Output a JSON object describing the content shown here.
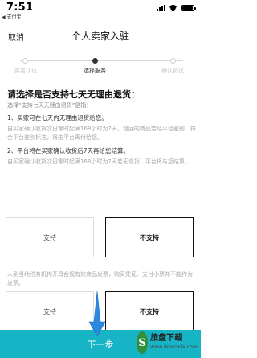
{
  "status_bar": {
    "time": "7:51",
    "back_app": "◀ 支付宝",
    "signal_icon": "signal-icon",
    "wifi_icon": "wifi-icon",
    "battery_icon": "battery-icon"
  },
  "nav": {
    "cancel_label": "取消",
    "title": "个人卖家入驻"
  },
  "steps": [
    {
      "label": "实名认证",
      "active": false
    },
    {
      "label": "选择服务",
      "active": true
    },
    {
      "label": "确认协议",
      "active": false
    }
  ],
  "main": {
    "question": "请选择是否支持七天无理由退货：",
    "subtitle": "选择“支持七天无理由退货”是指：",
    "items": [
      {
        "title": "1、买家可在七天内无理由退货给您。",
        "desc": "自买家确认收货次日零时起满168小时为7天，退回的商品若经平台鉴别，符合平台鉴别标准，将由平台寄付给您。"
      },
      {
        "title": "2、平台将在买家确认收货后7天再给您结算。",
        "desc": "自买家确认收货次日零时起满168小时为7天若无退货，平台将与您结算。"
      }
    ]
  },
  "options_return": {
    "support_label": "支持",
    "not_support_label": "不支持",
    "selected": "不支持"
  },
  "invoice_notice": "人到当地税务机构开具合规有效商品发票，购买凭证、支付小票并不能作为发票。",
  "options_invoice": {
    "support_label": "支持",
    "not_support_label": "不支持",
    "selected": "不支持"
  },
  "footer": {
    "next_label": "下一步"
  },
  "watermark": {
    "logo_char": "S",
    "name": "旅盘下载",
    "url": "www.downxia.com"
  },
  "colors": {
    "accent": "#17b4c6",
    "selected_border": "#111111",
    "arrow": "#2b8ae0"
  }
}
